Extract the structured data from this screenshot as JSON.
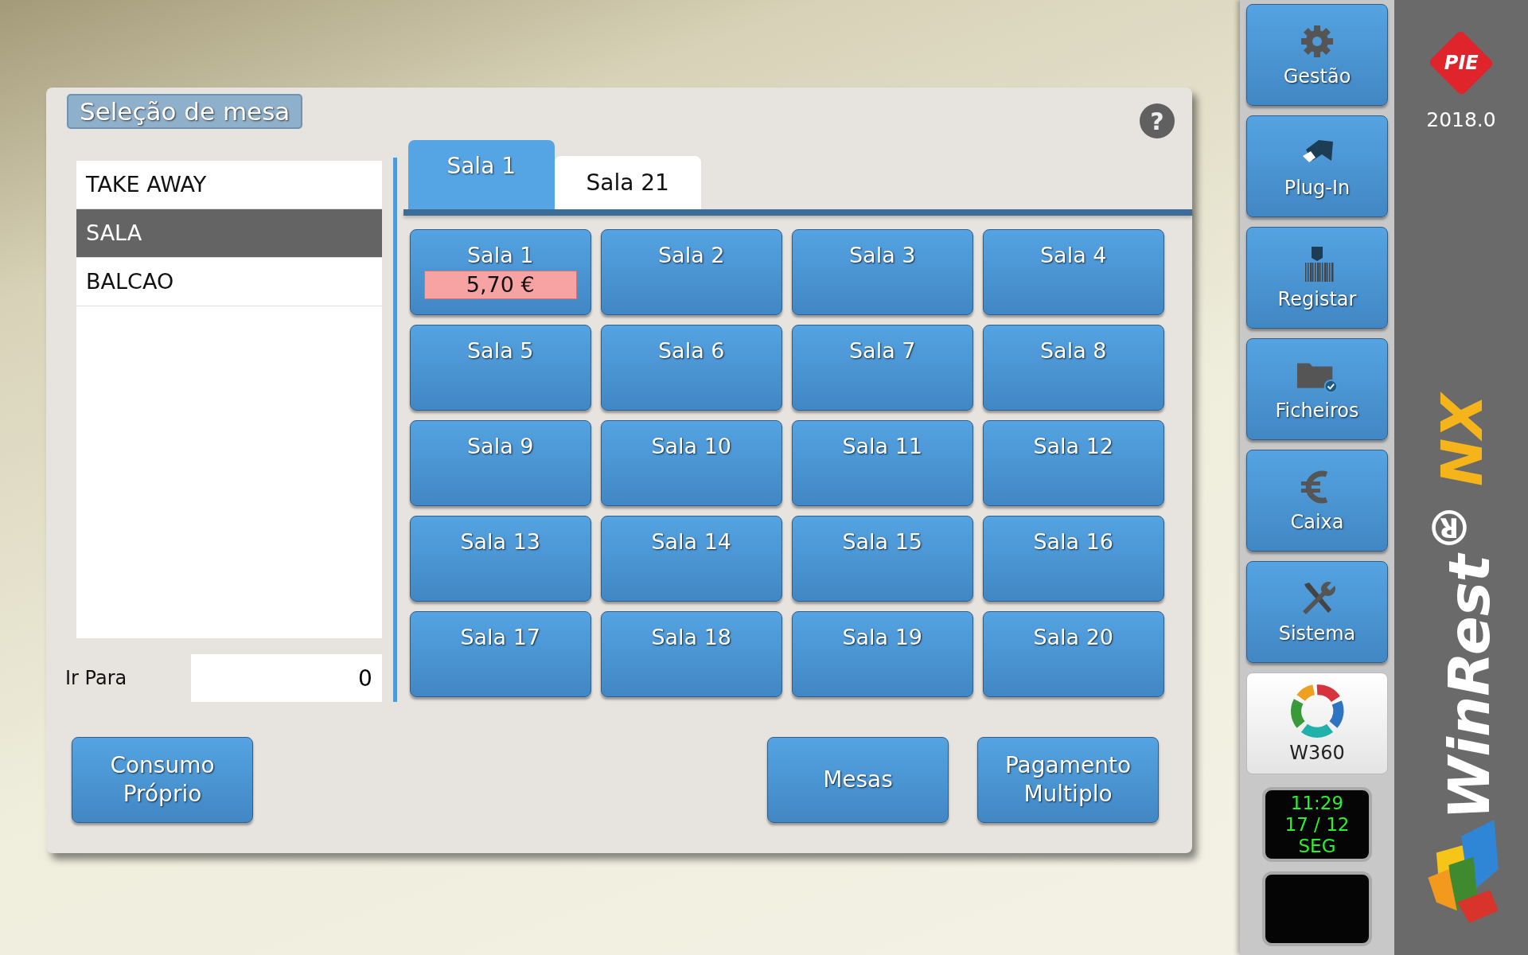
{
  "dialog": {
    "title": "Seleção de mesa",
    "help": "?",
    "areas": [
      {
        "label": "TAKE AWAY",
        "selected": false
      },
      {
        "label": "SALA",
        "selected": true
      },
      {
        "label": "BALCAO",
        "selected": false
      }
    ],
    "goto": {
      "label": "Ir Para",
      "value": "0"
    },
    "tabs": [
      {
        "label": "Sala 1",
        "selected": true
      },
      {
        "label": "Sala 21",
        "selected": false
      }
    ],
    "tables": [
      {
        "label": "Sala 1",
        "amount": "5,70 €"
      },
      {
        "label": "Sala 2"
      },
      {
        "label": "Sala 3"
      },
      {
        "label": "Sala 4"
      },
      {
        "label": "Sala 5"
      },
      {
        "label": "Sala 6"
      },
      {
        "label": "Sala 7"
      },
      {
        "label": "Sala 8"
      },
      {
        "label": "Sala 9"
      },
      {
        "label": "Sala 10"
      },
      {
        "label": "Sala 11"
      },
      {
        "label": "Sala 12"
      },
      {
        "label": "Sala 13"
      },
      {
        "label": "Sala 14"
      },
      {
        "label": "Sala 15"
      },
      {
        "label": "Sala 16"
      },
      {
        "label": "Sala 17"
      },
      {
        "label": "Sala 18"
      },
      {
        "label": "Sala 19"
      },
      {
        "label": "Sala 20"
      }
    ],
    "left_buttons": [
      "Consumo Próprio"
    ],
    "right_buttons": [
      "Mesas",
      "Pagamento Multiplo"
    ]
  },
  "launcher": {
    "buttons": [
      {
        "label": "Gestão",
        "kind": "gear"
      },
      {
        "label": "Plug-In",
        "kind": "plug"
      },
      {
        "label": "Registar",
        "kind": "register"
      },
      {
        "label": "Ficheiros",
        "kind": "folder"
      },
      {
        "label": "Caixa",
        "kind": "euro"
      },
      {
        "label": "Sistema",
        "kind": "tools"
      }
    ],
    "w360": "W360",
    "clock": [
      "11:29",
      "17 / 12",
      "SEG"
    ]
  },
  "brand": {
    "badge": "PIE",
    "version": "2018.0",
    "name": "WinRest$^{®}$",
    "suffix": "NX"
  }
}
